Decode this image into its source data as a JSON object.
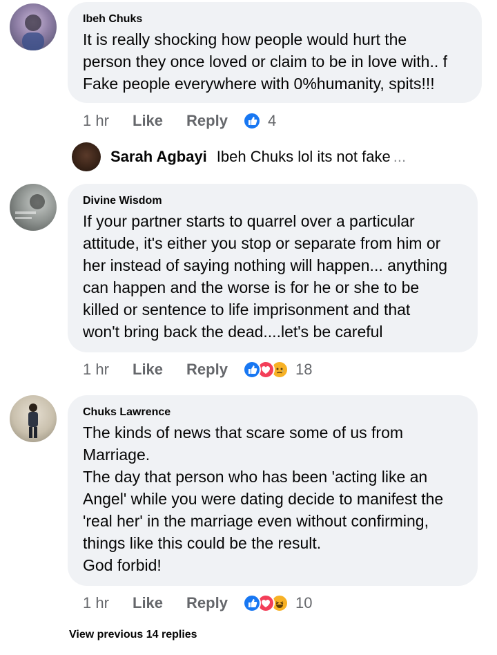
{
  "colors": {
    "like_blue": "#1877f2",
    "love_red": "#f33e58",
    "haha_yellow": "#f7b125",
    "muted": "#65676b"
  },
  "comments": [
    {
      "author": "Ibeh Chuks",
      "text": "It is really shocking how people would hurt the\nperson they once loved or claim to be in love with.. f\nFake people everywhere with 0%humanity, spits!!!",
      "time": "1 hr",
      "like_label": "Like",
      "reply_label": "Reply",
      "reactions": [
        "like-icon"
      ],
      "reaction_count": "4"
    },
    {
      "author": "Divine Wisdom",
      "text": "If your partner starts to quarrel over a particular\nattitude, it's either you stop or separate from him or\nher instead of saying nothing will happen... anything\ncan happen and the worse is for he or she to be\nkilled or sentence to life imprisonment and that\nwon't bring back the dead....let's be careful",
      "time": "1 hr",
      "like_label": "Like",
      "reply_label": "Reply",
      "reactions": [
        "like-icon",
        "love-icon",
        "sad-icon"
      ],
      "reaction_count": "18"
    },
    {
      "author": "Chuks Lawrence",
      "text": "The kinds of news that scare some of us from\nMarriage.\nThe day that person who has been 'acting like an\nAngel' while you were dating decide to manifest the\n'real her' in the marriage even without confirming,\nthings like this could be the result.\nGod forbid!",
      "time": "1 hr",
      "like_label": "Like",
      "reply_label": "Reply",
      "reactions": [
        "like-icon",
        "love-icon",
        "haha-icon"
      ],
      "reaction_count": "10"
    }
  ],
  "reply_preview": {
    "author": "Sarah Agbayi",
    "text": "Ibeh Chuks lol its not fake",
    "more": "..."
  },
  "view_previous_label": "View previous 14 replies"
}
